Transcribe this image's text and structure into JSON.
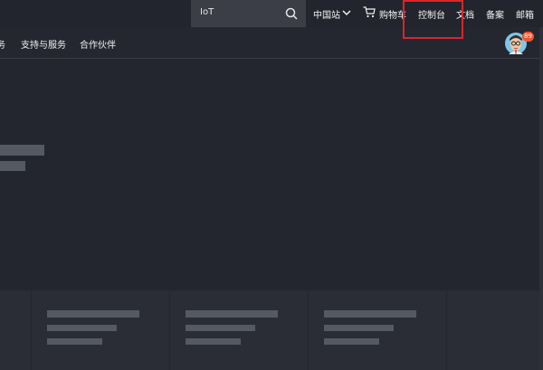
{
  "topbar": {
    "search": {
      "value": "IoT",
      "icon": "search-icon"
    },
    "region": {
      "label": "中国站",
      "icon": "chevron-down-icon"
    },
    "cart": {
      "label": "购物车",
      "icon": "cart-icon"
    },
    "console": {
      "label": "控制台"
    },
    "docs": {
      "label": "文档"
    },
    "beian": {
      "label": "备案"
    },
    "mail": {
      "label": "邮箱"
    }
  },
  "nav": {
    "partial": "务",
    "support": "支持与服务",
    "partners": "合作伙伴"
  },
  "user": {
    "badge": "89"
  },
  "colors": {
    "background": "#23262f",
    "highlight": "#d9252a",
    "badge": "#f2542d"
  }
}
